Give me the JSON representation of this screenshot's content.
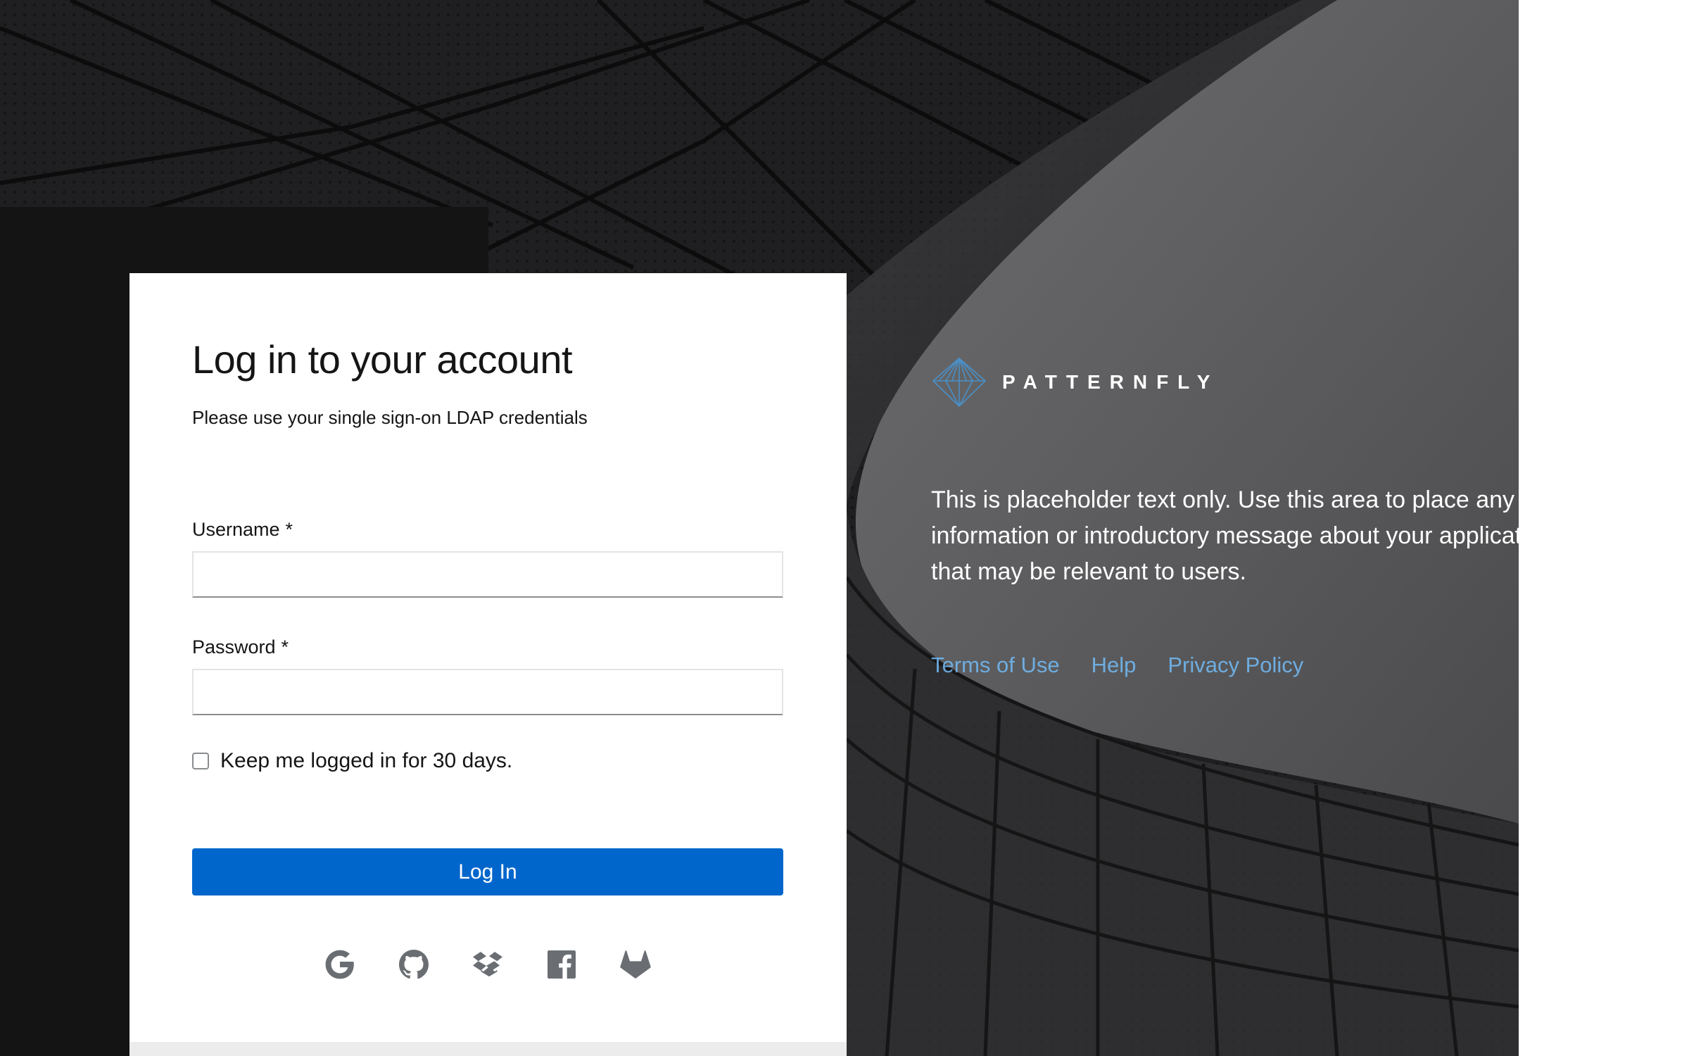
{
  "login": {
    "title": "Log in to your account",
    "subtitle": "Please use your single sign-on LDAP credentials",
    "username_label": "Username",
    "password_label": "Password",
    "required_marker": "*",
    "username_value": "",
    "password_value": "",
    "remember_label": "Keep me logged in for 30 days.",
    "remember_checked": false,
    "submit_label": "Log In"
  },
  "social_logins": [
    {
      "icon": "google-icon"
    },
    {
      "icon": "github-icon"
    },
    {
      "icon": "dropbox-icon"
    },
    {
      "icon": "facebook-icon"
    },
    {
      "icon": "gitlab-icon"
    }
  ],
  "brand": {
    "name": "PATTERNFLY",
    "logo_icon": "patternfly-logo-icon"
  },
  "intro": {
    "lines": [
      "This is placeholder text only. Use this area to place any",
      "information or introductory message about your application",
      "that may be relevant to users."
    ]
  },
  "footer_links": {
    "terms": "Terms of Use",
    "help": "Help",
    "privacy": "Privacy Policy"
  },
  "colors": {
    "primary": "#0066cc",
    "link": "#73bcf7",
    "card_bg": "#ffffff",
    "text": "#151515"
  }
}
